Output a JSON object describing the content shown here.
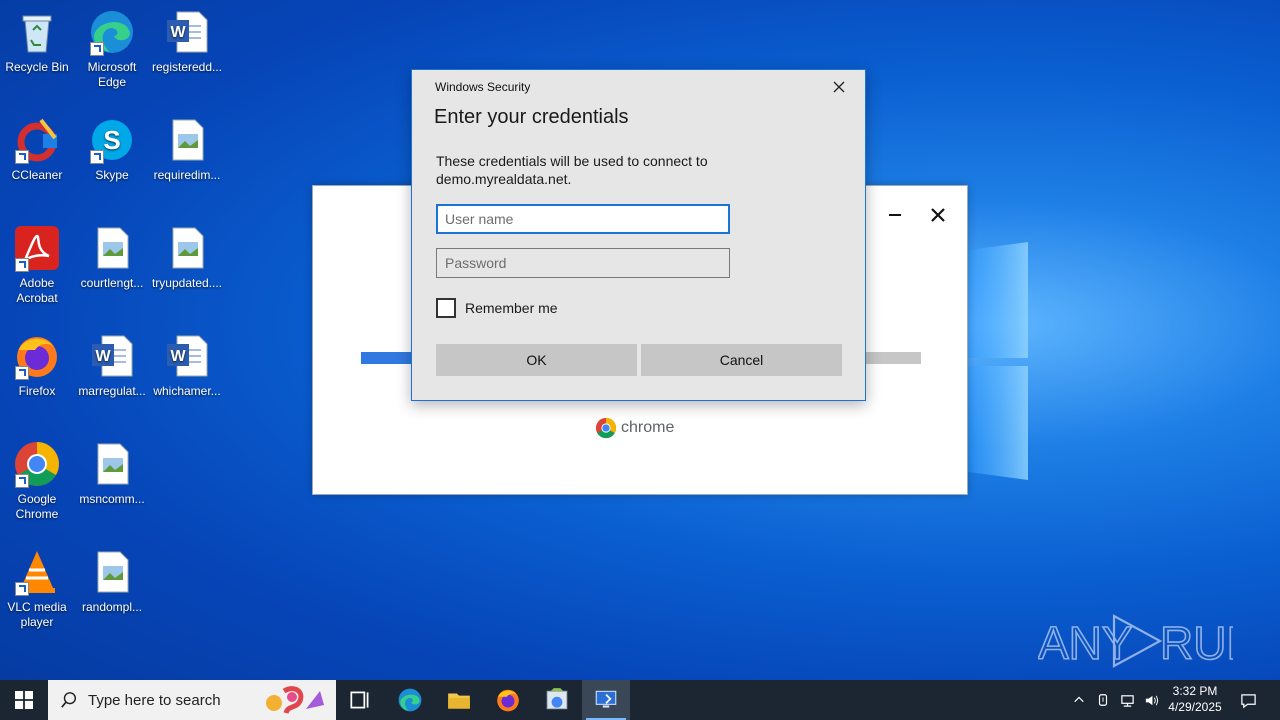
{
  "desktop": {
    "icons": [
      {
        "label": "Recycle Bin",
        "icon": "recycle-bin-icon"
      },
      {
        "label": "Microsoft Edge",
        "icon": "edge-icon"
      },
      {
        "label": "registeredd...",
        "icon": "word-doc-icon"
      },
      {
        "label": "CCleaner",
        "icon": "ccleaner-icon"
      },
      {
        "label": "Skype",
        "icon": "skype-icon"
      },
      {
        "label": "requiredim...",
        "icon": "image-file-icon"
      },
      {
        "label": "Adobe Acrobat",
        "icon": "acrobat-icon"
      },
      {
        "label": "courtlengt...",
        "icon": "image-file-icon"
      },
      {
        "label": "tryupdated....",
        "icon": "image-file-icon"
      },
      {
        "label": "Firefox",
        "icon": "firefox-icon"
      },
      {
        "label": "marregulat...",
        "icon": "word-doc-icon"
      },
      {
        "label": "whichamer...",
        "icon": "word-doc-icon"
      },
      {
        "label": "Google Chrome",
        "icon": "chrome-icon"
      },
      {
        "label": "msncomm...",
        "icon": "image-file-icon"
      },
      {
        "label": "VLC media player",
        "icon": "vlc-icon"
      },
      {
        "label": "randompl...",
        "icon": "image-file-icon"
      }
    ]
  },
  "installer": {
    "brand_text": "chrome",
    "progress": 0.09
  },
  "dialog": {
    "caption": "Windows Security",
    "heading": "Enter your credentials",
    "description": "These credentials will be used to connect to demo.myrealdata.net.",
    "username_placeholder": "User name",
    "username_value": "",
    "password_placeholder": "Password",
    "password_value": "",
    "remember_label": "Remember me",
    "remember_checked": false,
    "ok_label": "OK",
    "cancel_label": "Cancel"
  },
  "watermark": {
    "text": "ANY RUN"
  },
  "taskbar": {
    "search_placeholder": "Type here to search",
    "clock_time": "3:32 PM",
    "clock_date": "4/29/2025",
    "accent": "#7ab8ff"
  }
}
